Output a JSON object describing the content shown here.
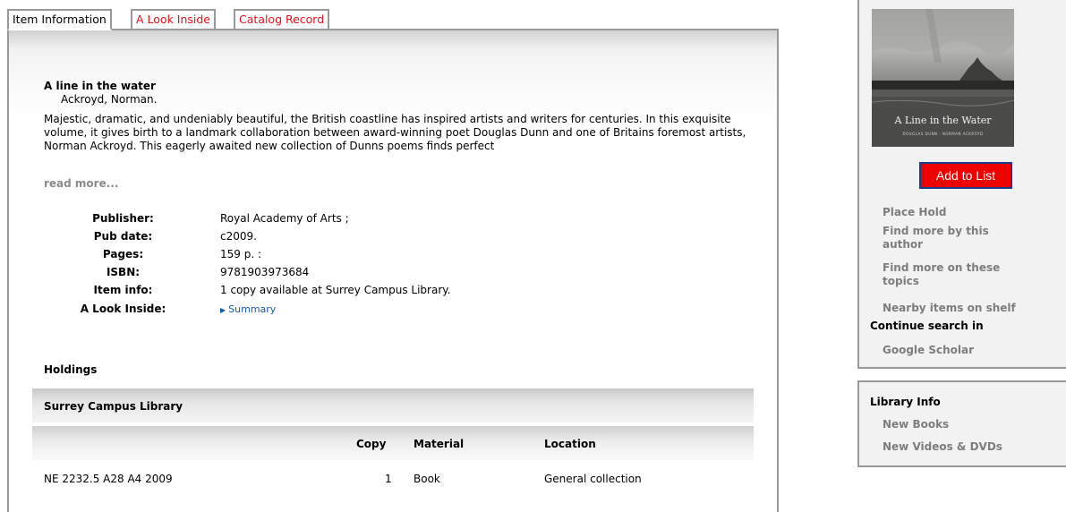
{
  "tabs": [
    {
      "label": "Item Information",
      "active": true
    },
    {
      "label": "A Look Inside",
      "active": false
    },
    {
      "label": "Catalog Record",
      "active": false
    }
  ],
  "item": {
    "title": "A line in the water",
    "author": "Ackroyd, Norman.",
    "description": "Majestic, dramatic, and undeniably beautiful, the British coastline has inspired artists and writers for centuries. In this exquisite volume, it gives birth to a landmark collaboration between award-winning poet Douglas Dunn and one of Britains foremost artists, Norman Ackroyd. This eagerly awaited new collection of Dunns poems finds perfect",
    "read_more": "read more..."
  },
  "details": [
    {
      "label": "Publisher:",
      "value": "Royal Academy of Arts ;"
    },
    {
      "label": "Pub date:",
      "value": "c2009."
    },
    {
      "label": "Pages:",
      "value": "159 p. :"
    },
    {
      "label": "ISBN:",
      "value": "9781903973684"
    },
    {
      "label": "Item info:",
      "value": "1 copy available at Surrey Campus Library."
    },
    {
      "label": "A Look Inside:",
      "value": "Summary"
    }
  ],
  "holdings": {
    "heading": "Holdings",
    "library": "Surrey Campus Library",
    "columns": {
      "copy": "Copy",
      "material": "Material",
      "location": "Location"
    },
    "rows": [
      {
        "call_number": "NE 2232.5 A28 A4 2009",
        "copy": "1",
        "material": "Book",
        "location": "General collection"
      }
    ]
  },
  "sidebar": {
    "cover": {
      "title": "A Line in the Water",
      "subtitle": "DOUGLAS DUNN · NORMAN ACKROYD"
    },
    "add_button": "Add to List",
    "links": [
      "Place Hold",
      "Find more by this author",
      "Find more on these topics",
      "Nearby items on shelf"
    ],
    "continue_heading": "Continue search in",
    "continue_links": [
      "Google Scholar"
    ],
    "library_info": {
      "heading": "Library Info",
      "links": [
        "New Books",
        "New Videos & DVDs"
      ]
    }
  },
  "colors": {
    "tab_inactive_text": "#e2111c",
    "add_button_bg": "#ee0000",
    "link_blue": "#1a5aa8",
    "sidebar_link_gray": "#7d7d7d"
  }
}
